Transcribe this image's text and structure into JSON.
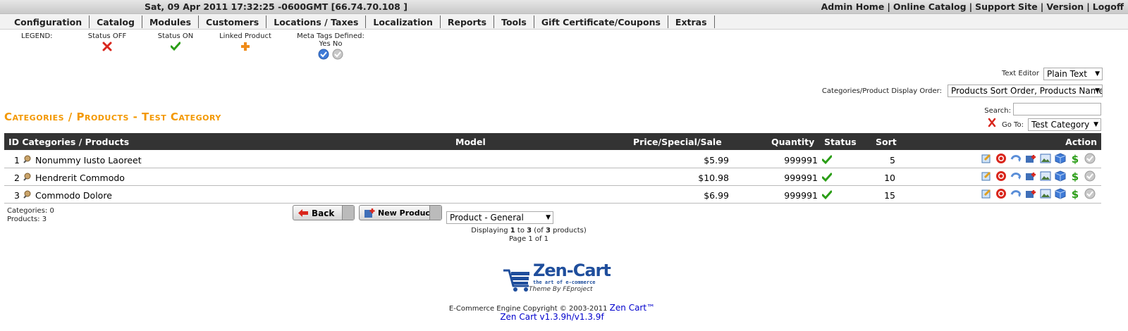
{
  "header": {
    "datetime": "Sat, 09 Apr 2011 17:32:25 -0600GMT [66.74.70.108 ]",
    "links": [
      "Admin Home",
      "Online Catalog",
      "Support Site",
      "Version",
      "Logoff"
    ]
  },
  "menu": [
    "Configuration",
    "Catalog",
    "Modules",
    "Customers",
    "Locations / Taxes",
    "Localization",
    "Reports",
    "Tools",
    "Gift Certificate/Coupons",
    "Extras"
  ],
  "legend": {
    "title": "LEGEND:",
    "status_off": "Status OFF",
    "status_on": "Status ON",
    "linked": "Linked Product",
    "meta": "Meta Tags Defined:",
    "yes_no": "Yes No"
  },
  "controls": {
    "text_editor_label": "Text Editor",
    "text_editor_value": "Plain Text",
    "display_order_label": "Categories/Product Display Order:",
    "display_order_value": "Products Sort Order, Products Name",
    "search_label": "Search:",
    "goto_label": "Go To:",
    "goto_value": "Test Category"
  },
  "page_title": "Categories / Products - Test Category",
  "table": {
    "headers": {
      "id": "ID Categories / Products",
      "model": "Model",
      "price": "Price/Special/Sale",
      "quantity": "Quantity",
      "status": "Status",
      "sort": "Sort",
      "action": "Action"
    },
    "rows": [
      {
        "id": "1",
        "name": "Nonummy Iusto Laoreet",
        "price": "$5.99",
        "quantity": "999991",
        "sort": "5"
      },
      {
        "id": "2",
        "name": "Hendrerit Commodo",
        "price": "$10.98",
        "quantity": "999991",
        "sort": "10"
      },
      {
        "id": "3",
        "name": "Commodo Dolore",
        "price": "$6.99",
        "quantity": "999991",
        "sort": "15"
      }
    ]
  },
  "footer_counts": {
    "categories": "Categories: 0",
    "products": "Products: 3"
  },
  "buttons": {
    "back": "Back",
    "new_product": "New Product",
    "product_type": "Product - General"
  },
  "pagination": {
    "prefix": "Displaying ",
    "from": "1",
    "to_word": " to ",
    "to": "3",
    "of_open": " (of ",
    "total": "3",
    "of_close": " products)",
    "page": "Page 1 of 1"
  },
  "logo": {
    "name": "Zen-Cart",
    "tagline": "the art of e-commerce",
    "theme": "Theme By FEproject"
  },
  "copyright": {
    "text": "E-Commerce Engine Copyright © 2003-2011 ",
    "link": "Zen Cart™",
    "version": "Zen Cart v1.3.9h/v1.3.9f"
  },
  "colors": {
    "heading": "#f39800",
    "table_header": "#333333",
    "status_on": "#2a9d16",
    "status_off": "#d9261c"
  }
}
